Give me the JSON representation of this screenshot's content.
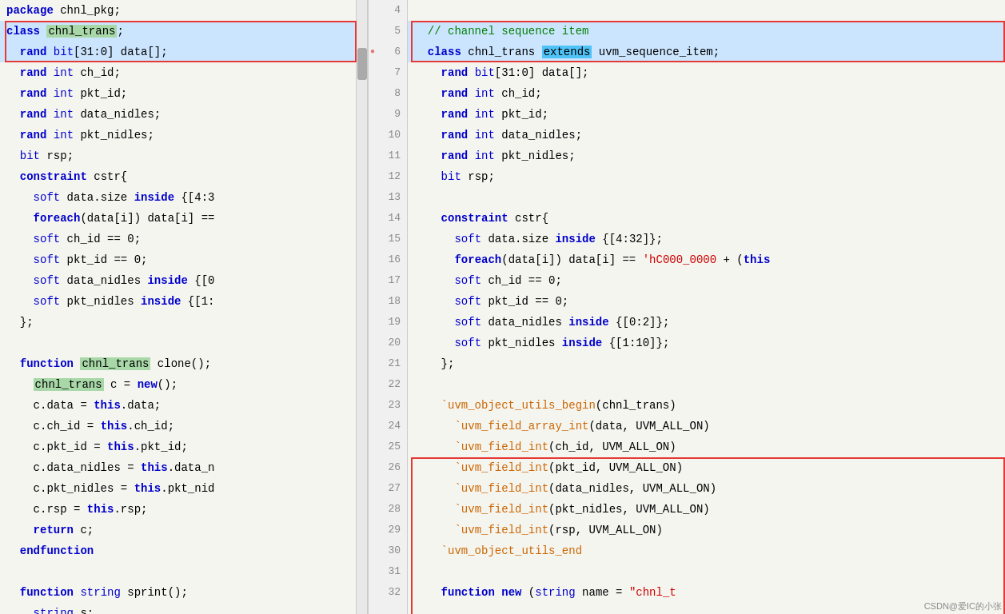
{
  "left": {
    "lines": [
      {
        "num": "",
        "content": "package_line",
        "text": "package chnl_pkg;"
      },
      {
        "num": "",
        "content": "class_line",
        "text": "class chnl_trans;"
      },
      {
        "num": "",
        "content": "rand_bit",
        "text": "  rand bit[31:0] data[];"
      },
      {
        "num": "",
        "content": "rand_int_ch",
        "text": "  rand int ch_id;"
      },
      {
        "num": "",
        "content": "rand_int_pkt",
        "text": "  rand int pkt_id;"
      },
      {
        "num": "",
        "content": "rand_int_data",
        "text": "  rand int data_nidles;"
      },
      {
        "num": "",
        "content": "rand_int_pkt_n",
        "text": "  rand int pkt_nidles;"
      },
      {
        "num": "",
        "content": "bit_rsp",
        "text": "  bit rsp;"
      },
      {
        "num": "",
        "content": "constraint",
        "text": "  constraint cstr{"
      },
      {
        "num": "",
        "content": "soft_data",
        "text": "    soft data.size inside {[4:3"
      },
      {
        "num": "",
        "content": "foreach",
        "text": "    foreach(data[i]) data[i] =="
      },
      {
        "num": "",
        "content": "soft_ch",
        "text": "    soft ch_id == 0;"
      },
      {
        "num": "",
        "content": "soft_pkt",
        "text": "    soft pkt_id == 0;"
      },
      {
        "num": "",
        "content": "soft_data_n",
        "text": "    soft data_nidles inside {[0"
      },
      {
        "num": "",
        "content": "soft_pkt_n",
        "text": "    soft pkt_nidles inside {[1:"
      },
      {
        "num": "",
        "content": "close_brace",
        "text": "  };"
      },
      {
        "num": "",
        "content": "blank1",
        "text": ""
      },
      {
        "num": "",
        "content": "function_clone",
        "text": "  function chnl_trans clone();"
      },
      {
        "num": "",
        "content": "chnl_c",
        "text": "    chnl_trans c = new();"
      },
      {
        "num": "",
        "content": "c_data",
        "text": "    c.data = this.data;"
      },
      {
        "num": "",
        "content": "c_ch",
        "text": "    c.ch_id = this.ch_id;"
      },
      {
        "num": "",
        "content": "c_pkt",
        "text": "    c.pkt_id = this.pkt_id;"
      },
      {
        "num": "",
        "content": "c_data_n",
        "text": "    c.data_nidles = this.data_n"
      },
      {
        "num": "",
        "content": "c_pkt_n",
        "text": "    c.pkt_nidles = this.pkt_nid"
      },
      {
        "num": "",
        "content": "c_rsp",
        "text": "    c.rsp = this.rsp;"
      },
      {
        "num": "",
        "content": "return_c",
        "text": "    return c;"
      },
      {
        "num": "",
        "content": "endfunction",
        "text": "  endfunction"
      },
      {
        "num": "",
        "content": "blank2",
        "text": ""
      },
      {
        "num": "",
        "content": "function_string",
        "text": "  function string sprint();"
      },
      {
        "num": "",
        "content": "string_s",
        "text": "    string s;"
      }
    ]
  },
  "right": {
    "lines": [
      {
        "num": "4",
        "text": ""
      },
      {
        "num": "5",
        "text": "  // channel sequence item"
      },
      {
        "num": "6",
        "text": "  class chnl_trans extends uvm_sequence_item;"
      },
      {
        "num": "7",
        "text": "    rand bit[31:0] data[];"
      },
      {
        "num": "8",
        "text": "    rand int ch_id;"
      },
      {
        "num": "9",
        "text": "    rand int pkt_id;"
      },
      {
        "num": "10",
        "text": "    rand int data_nidles;"
      },
      {
        "num": "11",
        "text": "    rand int pkt_nidles;"
      },
      {
        "num": "12",
        "text": "    bit rsp;"
      },
      {
        "num": "13",
        "text": ""
      },
      {
        "num": "14",
        "text": "    constraint cstr{"
      },
      {
        "num": "15",
        "text": "      soft data.size inside {[4:32]};"
      },
      {
        "num": "16",
        "text": "      foreach(data[i]) data[i] == 'hC000_0000 + (this"
      },
      {
        "num": "17",
        "text": "      soft ch_id == 0;"
      },
      {
        "num": "18",
        "text": "      soft pkt_id == 0;"
      },
      {
        "num": "19",
        "text": "      soft data_nidles inside {[0:2]};"
      },
      {
        "num": "20",
        "text": "      soft pkt_nidles inside {[1:10]};"
      },
      {
        "num": "21",
        "text": "    };"
      },
      {
        "num": "22",
        "text": ""
      },
      {
        "num": "23",
        "text": "    `uvm_object_utils_begin(chnl_trans)"
      },
      {
        "num": "24",
        "text": "      `uvm_field_array_int(data, UVM_ALL_ON)"
      },
      {
        "num": "25",
        "text": "      `uvm_field_int(ch_id, UVM_ALL_ON)"
      },
      {
        "num": "26",
        "text": "      `uvm_field_int(pkt_id, UVM_ALL_ON)"
      },
      {
        "num": "27",
        "text": "      `uvm_field_int(data_nidles, UVM_ALL_ON)"
      },
      {
        "num": "28",
        "text": "      `uvm_field_int(pkt_nidles, UVM_ALL_ON)"
      },
      {
        "num": "29",
        "text": "      `uvm_field_int(rsp, UVM_ALL_ON)"
      },
      {
        "num": "30",
        "text": "    `uvm_object_utils_end"
      },
      {
        "num": "31",
        "text": ""
      },
      {
        "num": "32",
        "text": "    function new (string name = \"chnl_t"
      }
    ]
  },
  "watermark": "CSDN@爱IC的小张"
}
